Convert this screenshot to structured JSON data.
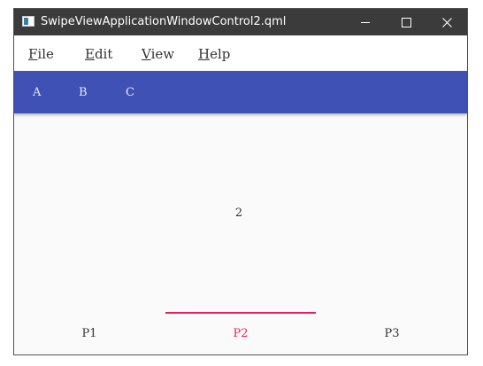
{
  "window": {
    "title": "SwipeViewApplicationWindowControl2.qml"
  },
  "menu": {
    "items": [
      {
        "mnemonic": "F",
        "rest": "ile"
      },
      {
        "mnemonic": "E",
        "rest": "dit"
      },
      {
        "mnemonic": "V",
        "rest": "iew"
      },
      {
        "mnemonic": "H",
        "rest": "elp"
      }
    ]
  },
  "header_tabs": [
    "A",
    "B",
    "C"
  ],
  "content": {
    "current_page": "2"
  },
  "footer_tabs": [
    "P1",
    "P2",
    "P3"
  ],
  "colors": {
    "titlebar": "#3b3b3b",
    "header": "#3f51b5",
    "accent": "#e91e63"
  },
  "icons": [
    "app-icon",
    "minimize-icon",
    "maximize-icon",
    "close-icon"
  ]
}
